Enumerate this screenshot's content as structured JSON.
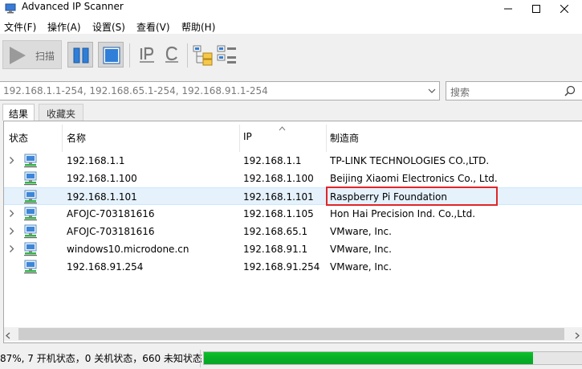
{
  "window": {
    "title": "Advanced IP Scanner"
  },
  "menu": [
    "文件(F)",
    "操作(A)",
    "设置(S)",
    "查看(V)",
    "帮助(H)"
  ],
  "toolbar": {
    "scan_label": "扫描",
    "ip_button_letter": "IP",
    "c_button_letter": "C"
  },
  "range": {
    "value": "192.168.1.1-254, 192.168.65.1-254, 192.168.91.1-254"
  },
  "search": {
    "placeholder": "搜索"
  },
  "tabs": [
    "结果",
    "收藏夹"
  ],
  "columns": [
    "状态",
    "名称",
    "IP",
    "制造商"
  ],
  "rows": [
    {
      "name": "192.168.1.1",
      "ip": "192.168.1.1",
      "manufacturer": "TP-LINK TECHNOLOGIES CO.,LTD.",
      "expandable": true,
      "selected": false
    },
    {
      "name": "192.168.1.100",
      "ip": "192.168.1.100",
      "manufacturer": "Beijing Xiaomi Electronics Co., Ltd.",
      "expandable": false,
      "selected": false
    },
    {
      "name": "192.168.1.101",
      "ip": "192.168.1.101",
      "manufacturer": "Raspberry Pi Foundation",
      "expandable": false,
      "selected": true
    },
    {
      "name": "AFOJC-703181616",
      "ip": "192.168.1.105",
      "manufacturer": "Hon Hai Precision Ind. Co.,Ltd.",
      "expandable": true,
      "selected": false
    },
    {
      "name": "AFOJC-703181616",
      "ip": "192.168.65.1",
      "manufacturer": "VMware, Inc.",
      "expandable": true,
      "selected": false
    },
    {
      "name": "windows10.microdone.cn",
      "ip": "192.168.91.1",
      "manufacturer": "VMware, Inc.",
      "expandable": true,
      "selected": false
    },
    {
      "name": "192.168.91.254",
      "ip": "192.168.91.254",
      "manufacturer": "VMware, Inc.",
      "expandable": false,
      "selected": false
    }
  ],
  "status": {
    "text": "87%, 7 开机状态，0 关机状态，660 未知状态",
    "progress": 0.87
  },
  "colors": {
    "progress_fill": "#06b025",
    "selection": "#e5f1fb",
    "highlight_box": "#e0262a"
  }
}
